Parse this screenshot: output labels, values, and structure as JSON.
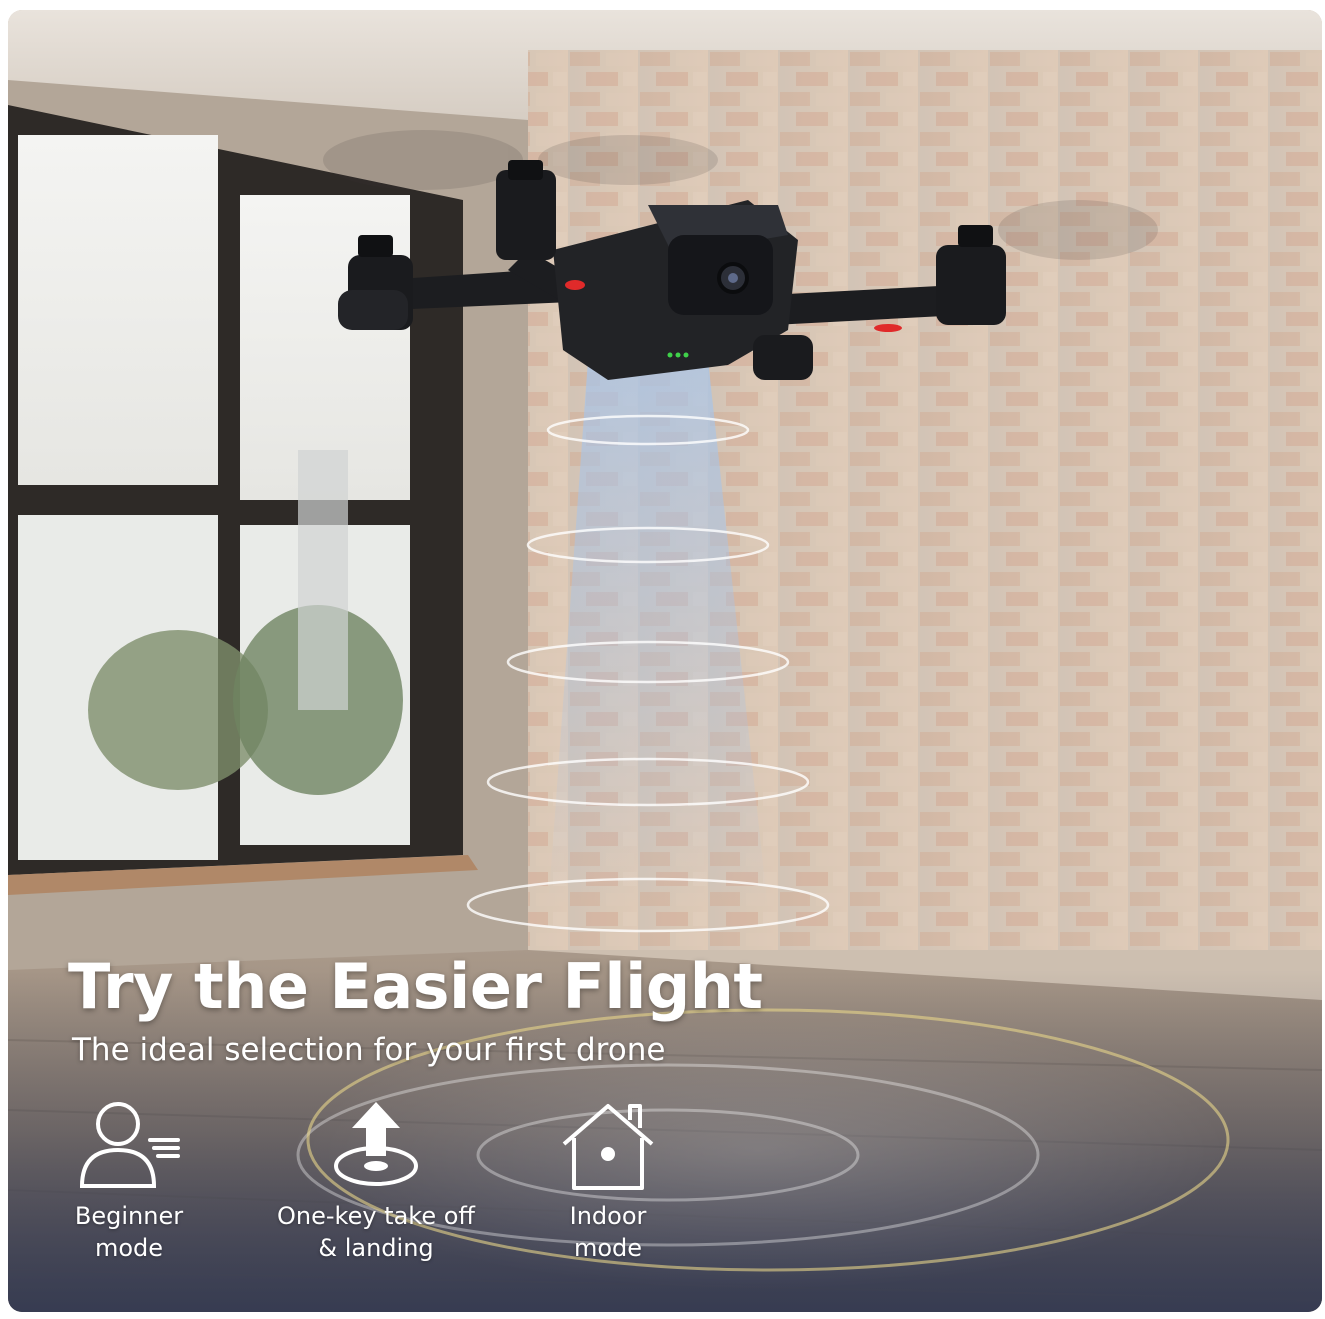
{
  "hero": {
    "headline": "Try the Easier Flight",
    "subline": "The ideal selection for your first drone"
  },
  "features": [
    {
      "icon": "beginner-user-icon",
      "label": "Beginner\nmode"
    },
    {
      "icon": "takeoff-landing-arrow-icon",
      "label": "One-key take off\n& landing"
    },
    {
      "icon": "house-icon",
      "label": "Indoor\nmode"
    }
  ],
  "colors": {
    "text": "#ffffff",
    "brick_wall": "#c9a88e",
    "floor": "#8c7b6c",
    "drone_body": "#1c1d20",
    "drone_led_red": "#e02a2a",
    "drone_led_green": "#3fd14a",
    "sensor_beam": "#9fb7d6"
  }
}
